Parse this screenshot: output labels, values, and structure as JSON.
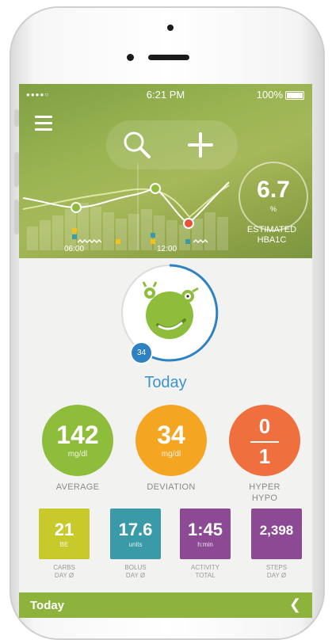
{
  "status_bar": {
    "signal": "●●●●○",
    "time": "6:21 PM",
    "battery": "100%"
  },
  "header": {
    "menu_icon": "hamburger-icon",
    "search_icon": "search-icon",
    "add_icon": "plus-icon",
    "hba1c": {
      "value": "6.7",
      "unit": "%",
      "label_line1": "ESTIMATED",
      "label_line2": "HBA1C"
    },
    "chart_ticks": [
      "06:00",
      "12:00"
    ]
  },
  "avatar": {
    "badge": "34"
  },
  "today_label": "Today",
  "stats": {
    "average": {
      "value": "142",
      "unit": "mg/dl",
      "label": "AVERAGE"
    },
    "deviation": {
      "value": "34",
      "unit": "mg/dl",
      "label": "DEVIATION"
    },
    "hyper_hypo": {
      "hyper": "0",
      "hypo": "1",
      "label_line1": "HYPER",
      "label_line2": "HYPO"
    }
  },
  "tiles": {
    "carbs": {
      "value": "21",
      "unit": "BE",
      "label_line1": "CARBS",
      "label_line2": "DAY Ø"
    },
    "bolus": {
      "value": "17.6",
      "unit": "units",
      "label_line1": "BOLUS",
      "label_line2": "DAY Ø"
    },
    "activity": {
      "value": "1:45",
      "unit": "h:min",
      "label_line1": "ACTIVITY",
      "label_line2": "TOTAL"
    },
    "steps": {
      "value": "2,398",
      "unit": "",
      "label_line1": "STEPS",
      "label_line2": "DAY Ø"
    }
  },
  "bottom_bar": {
    "title": "Today",
    "chevron_icon": "chevron-left-icon"
  },
  "colors": {
    "green": "#8dbd3a",
    "orange": "#f4a623",
    "red_orange": "#ef6f3e",
    "blue": "#3d94cc",
    "tile_yellow": "#c7ca2a",
    "tile_teal": "#3b9aa8",
    "tile_purple": "#8d4a94",
    "header_green": "#8fa347"
  }
}
